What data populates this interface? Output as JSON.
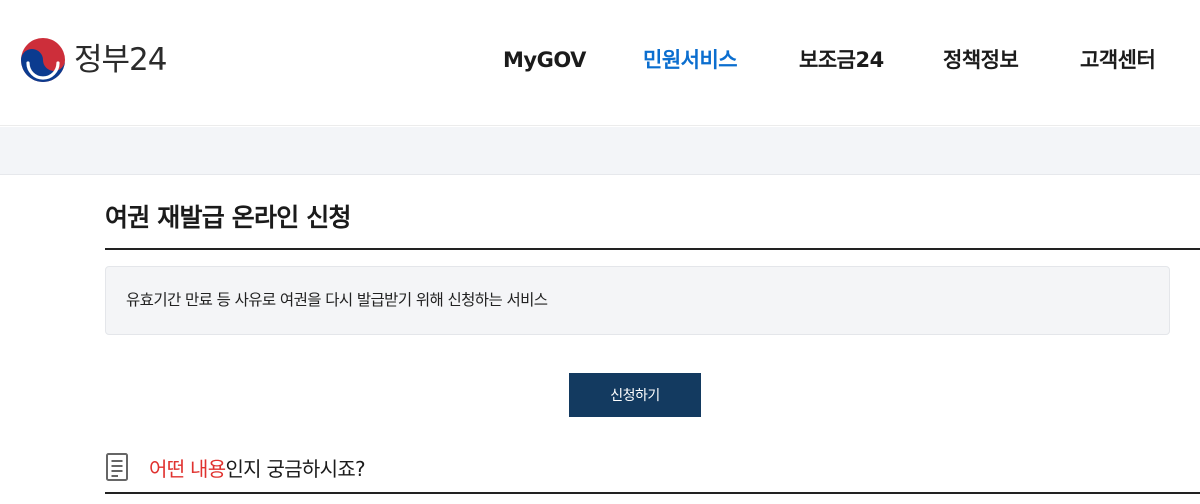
{
  "header": {
    "logo_text": "정부24",
    "logo_icon": "taegeuk-icon",
    "nav": [
      {
        "label": "MyGOV",
        "active": false
      },
      {
        "label": "민원서비스",
        "active": true
      },
      {
        "label": "보조금24",
        "active": false
      },
      {
        "label": "정책정보",
        "active": false
      },
      {
        "label": "고객센터",
        "active": false
      }
    ],
    "active_color": "#0b6ecf"
  },
  "main": {
    "title": "여권 재발급 온라인 신청",
    "description": "유효기간 만료 등 사유로 여권을 다시 발급받기 위해 신청하는 서비스",
    "apply_button_label": "신청하기",
    "apply_button_color": "#133a60",
    "faq": {
      "icon": "document-icon",
      "highlight": "어떤 내용",
      "rest": "인지 궁금하시죠?",
      "highlight_color": "#e0322f"
    }
  }
}
